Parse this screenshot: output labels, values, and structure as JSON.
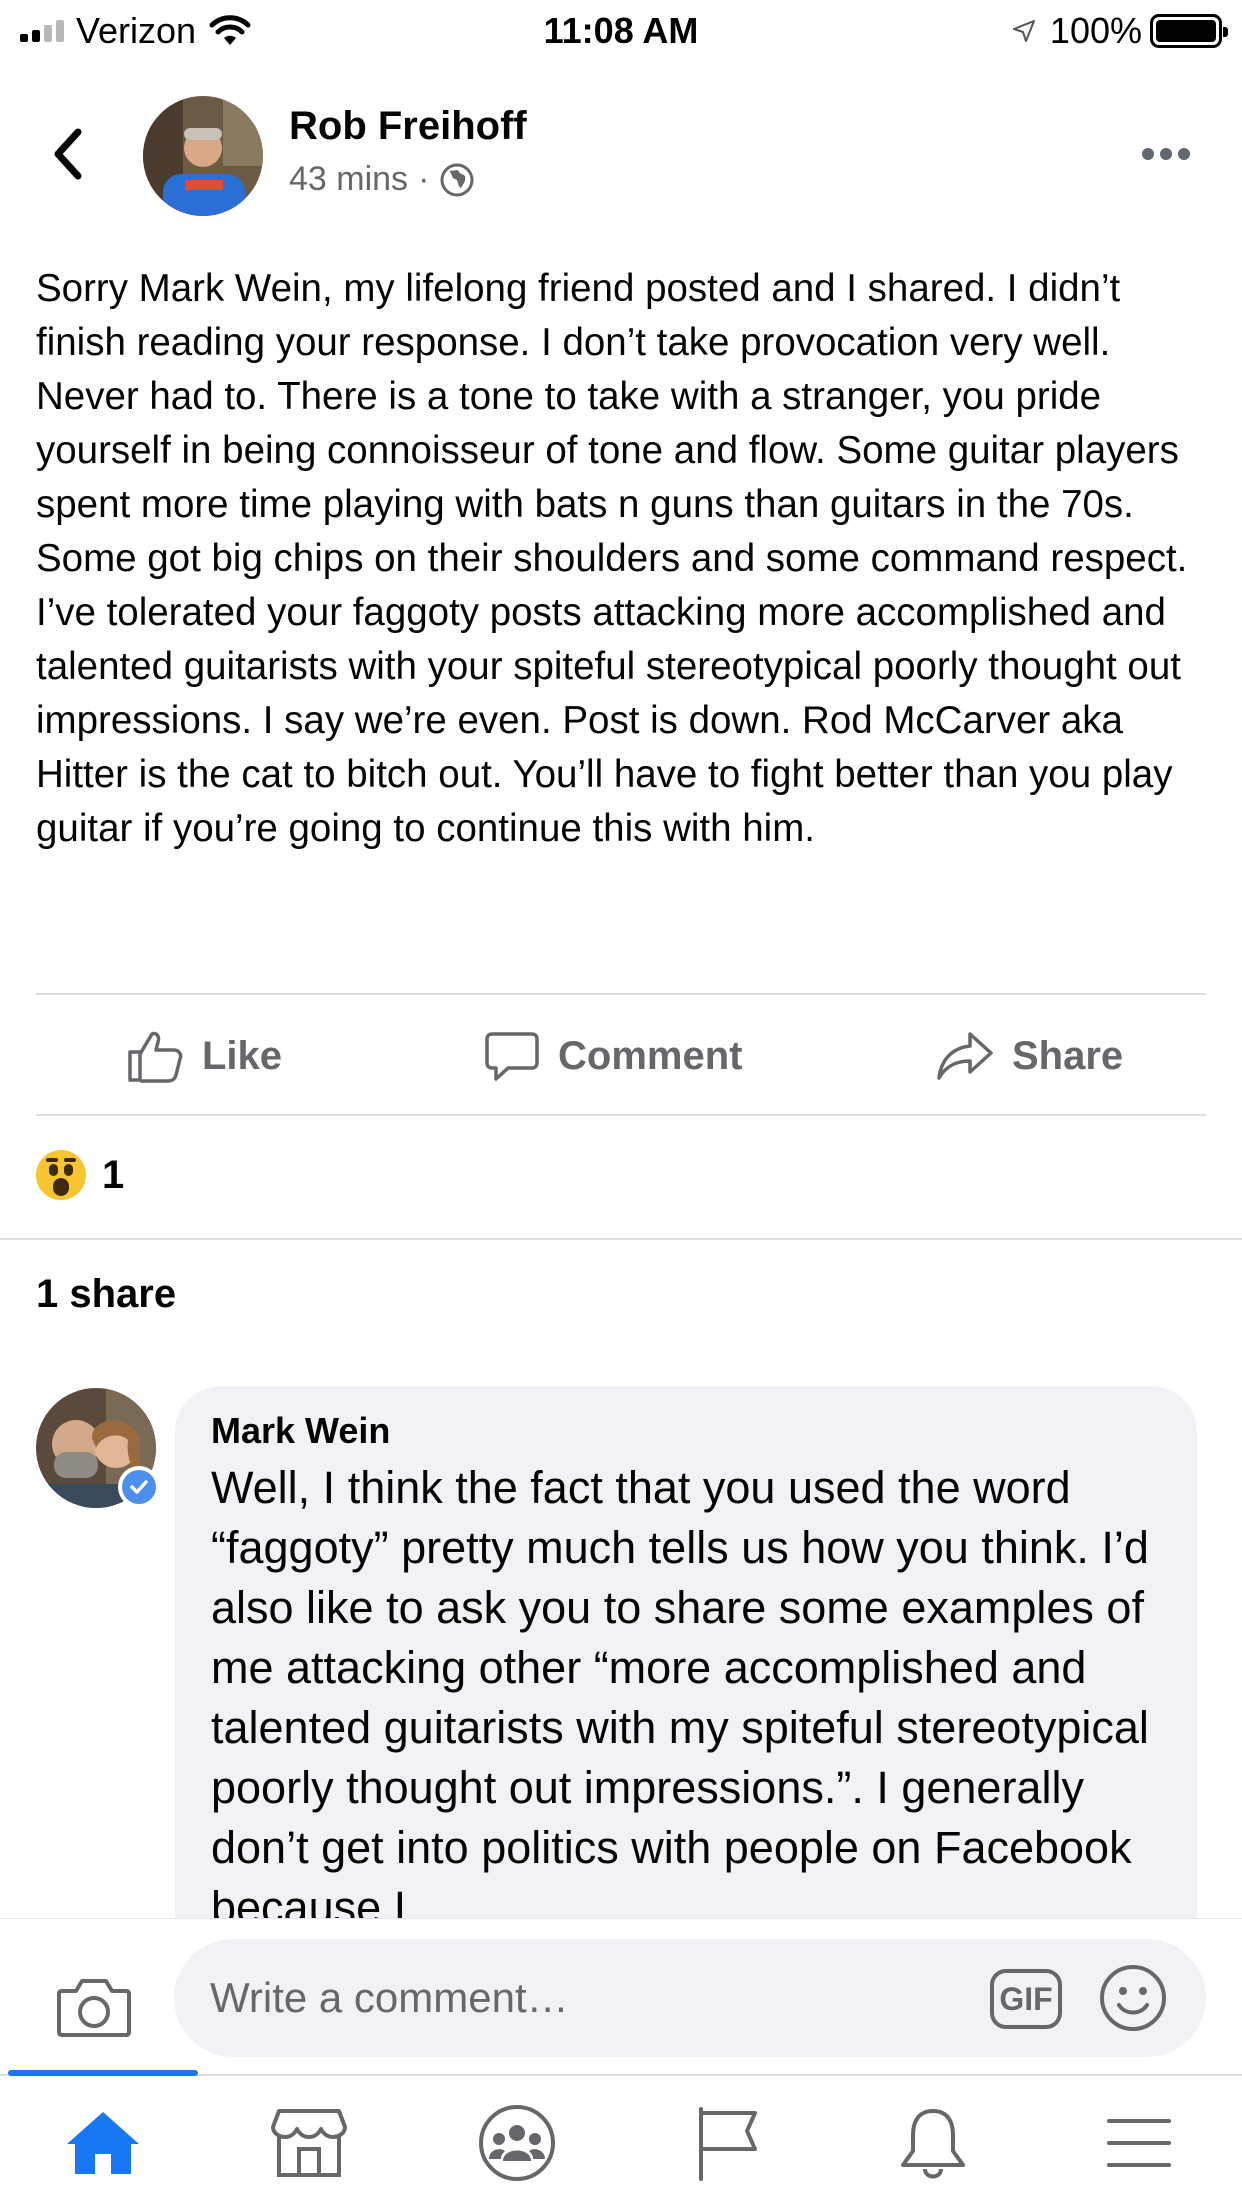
{
  "status_bar": {
    "carrier": "Verizon",
    "time": "11:08 AM",
    "battery_percent": "100%",
    "signal_bars_active": 2,
    "signal_bars_total": 4
  },
  "post": {
    "author": "Rob Freihoff",
    "timestamp": "43 mins",
    "meta_separator": "·",
    "privacy_icon": "globe-icon",
    "text": "Sorry Mark Wein, my lifelong friend posted and I shared. I didn’t finish reading your response. I don’t take provocation very well. Never had to. There is a tone to take with a stranger, you pride yourself in being connoisseur of tone and flow. Some guitar players spent more time playing with bats n guns than guitars in the 70s. Some got big chips on their shoulders and some command respect. I’ve tolerated your faggoty posts attacking more accomplished and talented guitarists with your spiteful stereotypical poorly thought out impressions. I say we’re even. Post is down. Rod McCarver aka Hitter is the cat to bitch out. You’ll have to fight better than you play guitar if you’re going to continue this with him."
  },
  "actions": {
    "like": "Like",
    "comment": "Comment",
    "share": "Share"
  },
  "reactions": {
    "type": "wow",
    "count": "1"
  },
  "shares": {
    "label": "1 share"
  },
  "comment": {
    "author": "Mark Wein",
    "verified": true,
    "text": "Well, I think the fact that you used the word “faggoty” pretty much tells us how you think.  I’d also like to ask you to share some examples of me attacking other “more accomplished and talented guitarists with my spiteful stereotypical poorly thought out impressions.”.  I generally don’t get into politics with people on Facebook because I"
  },
  "composer": {
    "placeholder": "Write a comment…",
    "gif_label": "GIF"
  },
  "tabbar": {
    "active_tab": "home",
    "tabs": [
      "home-icon",
      "marketplace-icon",
      "groups-icon",
      "pages-icon",
      "notifications-icon",
      "menu-icon"
    ]
  },
  "colors": {
    "accent": "#1877f2",
    "secondary_text": "#65676b",
    "bubble_bg": "#f0f2f5"
  }
}
